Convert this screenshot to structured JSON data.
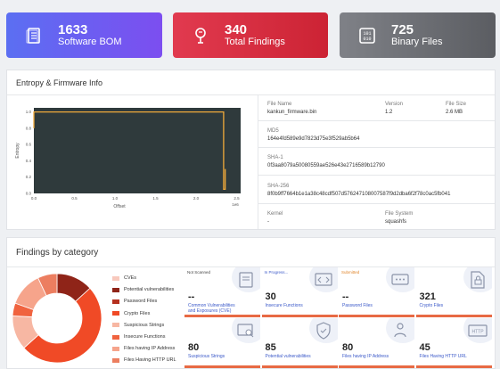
{
  "stats": [
    {
      "value": "1633",
      "label": "Software BOM",
      "icon": "document-icon"
    },
    {
      "value": "340",
      "label": "Total Findings",
      "icon": "bug-icon"
    },
    {
      "value": "725",
      "label": "Binary Files",
      "icon": "binary-icon"
    }
  ],
  "entropy": {
    "title": "Entropy  & Firmware Info",
    "chart_data": {
      "type": "line",
      "title": "",
      "xlabel": "Offset",
      "ylabel": "Entropy",
      "x_ticks": [
        "0.0",
        "0.5",
        "1.0",
        "1.5",
        "2.0",
        "2.5",
        "1e6"
      ],
      "y_ticks": [
        "0.0",
        "0.2",
        "0.4",
        "0.6",
        "0.8",
        "1.0"
      ],
      "xlim": [
        0,
        2.55
      ],
      "ylim": [
        0,
        1.05
      ],
      "grid": false,
      "background": "#2f3a3c",
      "line_color": "#f0a93a",
      "series": [
        {
          "x": [
            0.0,
            0.0,
            0.02,
            0.02,
            2.34,
            2.34,
            2.36,
            2.36
          ],
          "y": [
            0.8,
            1.0,
            1.0,
            1.0,
            1.0,
            0.05,
            0.05,
            0.3
          ]
        }
      ]
    }
  },
  "firmware": {
    "file_name_label": "File Name",
    "file_name": "kankun_firmware.bin",
    "version_label": "Version",
    "version": "1.2",
    "file_size_label": "File Size",
    "file_size": "2.6 MB",
    "md5_label": "MD5",
    "md5": "164e4fd589e9d7823d75e3f529ab5b64",
    "sha1_label": "SHA-1",
    "sha1": "0f3aa8079a50080559ae526e43e2716589b12790",
    "sha256_label": "SHA-256",
    "sha256": "8f0b9ff7664b1e1a38c48cdf507d576247108007587f9d2dba6f2f78c0ac5fb041",
    "kernel_label": "Kernel",
    "kernel": "-",
    "fs_label": "File System",
    "fs": "squashfs"
  },
  "findings": {
    "title": "Findings by category",
    "chart_data": {
      "type": "pie",
      "donut": true,
      "categories": [
        "CVEs",
        "Potential  vulnerabilities",
        "Password Files",
        "Crypto Files",
        "Suspicious Strings",
        "Insecure Functions",
        "Files having IP Address",
        "Files Having HTTP URL"
      ],
      "values": [
        0,
        85,
        0,
        321,
        80,
        30,
        80,
        45
      ],
      "colors": [
        "#f8c9bd",
        "#8f2418",
        "#b5301f",
        "#f04a26",
        "#f7b7a3",
        "#f0633f",
        "#f6a48b",
        "#ec7e60"
      ]
    },
    "tiles": [
      {
        "status": "Not Scanned",
        "status_color": "#444444",
        "value": "--",
        "name": "Common Vulnerabilities and Exposures (CVE)",
        "icon": "cve-icon"
      },
      {
        "status": "In Progress...",
        "status_color": "#3b59c9",
        "value": "30",
        "name": "Insecure Functions",
        "icon": "code-icon"
      },
      {
        "status": "Submitted",
        "status_color": "#e0862c",
        "value": "--",
        "name": "Password Files",
        "icon": "password-icon"
      },
      {
        "status": "",
        "status_color": "#444444",
        "value": "321",
        "name": "Crypto Files",
        "icon": "lock-file-icon"
      },
      {
        "status": "",
        "status_color": "#444444",
        "value": "80",
        "name": "Suspicious Strings",
        "icon": "magnifier-icon"
      },
      {
        "status": "",
        "status_color": "#444444",
        "value": "85",
        "name": "Potential vulnerabilities",
        "icon": "shield-icon"
      },
      {
        "status": "",
        "status_color": "#444444",
        "value": "80",
        "name": "Files having IP Address",
        "icon": "ip-address-icon"
      },
      {
        "status": "",
        "status_color": "#444444",
        "value": "45",
        "name": "Files Having HTTP URL",
        "icon": "http-icon"
      }
    ]
  }
}
